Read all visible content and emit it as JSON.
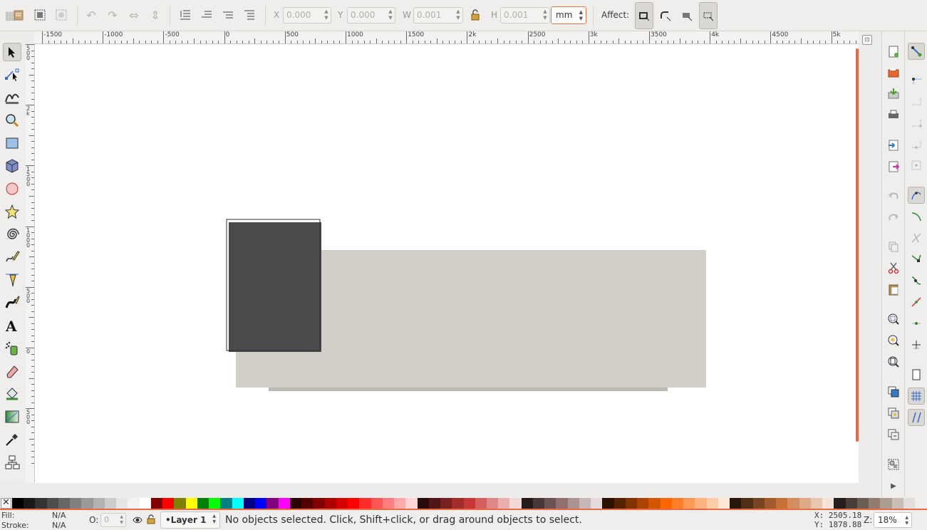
{
  "toolbar": {
    "x_label": "X",
    "x_value": "0.000",
    "y_label": "Y",
    "y_value": "0.000",
    "w_label": "W",
    "w_value": "0.001",
    "h_label": "H",
    "h_value": "0.001",
    "unit": "mm",
    "affect_label": "Affect:"
  },
  "ruler": {
    "labels": [
      "-1500",
      "-1000",
      "-500",
      "0",
      "500",
      "1000",
      "1500",
      "2k",
      "2500",
      "3k",
      "3500",
      "4k",
      "4500",
      "5k"
    ],
    "v_labels": [
      "500",
      "2k",
      "1500",
      "1000",
      "500",
      "0",
      "500"
    ]
  },
  "palette": {
    "swatches": [
      "#000000",
      "#1a1a1a",
      "#333333",
      "#4d4d4d",
      "#666666",
      "#808080",
      "#999999",
      "#b3b3b3",
      "#cccccc",
      "#e6e6e6",
      "#f2f2f2",
      "#ffffff",
      "#800000",
      "#ff0000",
      "#808000",
      "#ffff00",
      "#008000",
      "#00ff00",
      "#008080",
      "#00ffff",
      "#000080",
      "#0000ff",
      "#800080",
      "#ff00ff",
      "#2b0000",
      "#550000",
      "#800000",
      "#aa0000",
      "#d40000",
      "#ff0000",
      "#ff2a2a",
      "#ff5555",
      "#ff8080",
      "#ffaaaa",
      "#ffd5d5",
      "#280b0b",
      "#501616",
      "#782121",
      "#a02c2c",
      "#c83737",
      "#d35f5f",
      "#de8787",
      "#e9afaf",
      "#f4d7d7",
      "#241c1c",
      "#483737",
      "#6c5353",
      "#916f6f",
      "#ac9393",
      "#c8b7b7",
      "#e3dbdb",
      "#2b1100",
      "#552200",
      "#803300",
      "#aa4400",
      "#d45500",
      "#ff6600",
      "#ff7f2a",
      "#ff9955",
      "#ffb380",
      "#ffccaa",
      "#ffe6d5",
      "#28170b",
      "#502d16",
      "#784421",
      "#a05a2c",
      "#c87137",
      "#d38d5f",
      "#deaa87",
      "#e9c6af",
      "#f4e3d7",
      "#241f1c",
      "#483e37",
      "#6c5d53",
      "#917c6f",
      "#ac9d93",
      "#c8beb7",
      "#e3dedb"
    ]
  },
  "status": {
    "fill_label": "Fill:",
    "fill_value": "N/A",
    "stroke_label": "Stroke:",
    "stroke_value": "N/A",
    "opacity_label": "O:",
    "opacity_value": "0",
    "layer_name": "•Layer 1",
    "message": "No objects selected. Click, Shift+click, or drag around objects to select.",
    "cursor_x": "X: 2505.18",
    "cursor_y": "Y: 1878.88",
    "zoom_label": "Z:",
    "zoom_value": "18%"
  },
  "colors": {
    "accent": "#e86b43",
    "page_fill": "#d2cfc9",
    "shadow": "#bdbab4"
  }
}
